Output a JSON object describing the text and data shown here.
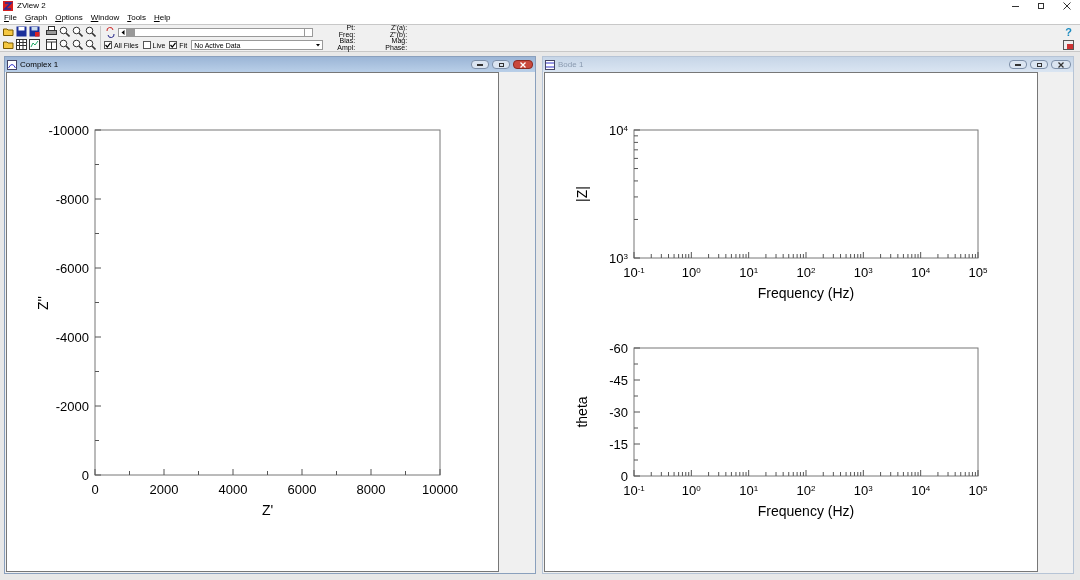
{
  "window": {
    "title": "ZView 2"
  },
  "menu": [
    "File",
    "Graph",
    "Options",
    "Window",
    "Tools",
    "Help"
  ],
  "toolbar": {
    "all_files": {
      "label": "All Files",
      "checked": true
    },
    "live": {
      "label": "Live",
      "checked": false
    },
    "fit": {
      "label": "Fit",
      "checked": true
    },
    "data_select": {
      "value": "No Active Data"
    },
    "readouts_left": [
      "Pt:",
      "Freq:",
      "Bias:",
      "Ampl:"
    ],
    "readouts_right": [
      "Z'(a):",
      "Z''(b):",
      "Mag:",
      "Phase:"
    ],
    "help": "?"
  },
  "complex_window": {
    "title": "Complex 1",
    "active": true,
    "chart_data": {
      "type": "scatter",
      "xlabel": "Z'",
      "ylabel": "Z''",
      "xlim": [
        0,
        10000
      ],
      "ylim": [
        0,
        -10000
      ],
      "xticks": [
        0,
        2000,
        4000,
        6000,
        8000,
        10000
      ],
      "yticks": [
        0,
        -2000,
        -4000,
        -6000,
        -8000,
        -10000
      ]
    }
  },
  "bode_window": {
    "title": "Bode 1",
    "active": false,
    "charts": [
      {
        "chart_data": {
          "type": "scatter",
          "xlabel": "Frequency (Hz)",
          "ylabel": "|Z|",
          "categories": [
            "10$^{-1}$",
            "10$^{0}$",
            "10$^{1}$",
            "10$^{2}$",
            "10$^{3}$",
            "10$^{4}$",
            "10$^{5}$"
          ],
          "ylim": [
            1000,
            10000
          ],
          "yticks": [
            {
              "value": 1000,
              "label": "10$^{3}$"
            },
            {
              "value": 10000,
              "label": "10$^{4}$"
            }
          ]
        }
      },
      {
        "chart_data": {
          "type": "scatter",
          "xlabel": "Frequency (Hz)",
          "ylabel": "theta",
          "categories": [
            "10$^{-1}$",
            "10$^{0}$",
            "10$^{1}$",
            "10$^{2}$",
            "10$^{3}$",
            "10$^{4}$",
            "10$^{5}$"
          ],
          "ylim": [
            0,
            -60
          ],
          "yticks": [
            0,
            -15,
            -30,
            -45,
            -60
          ]
        }
      }
    ]
  }
}
